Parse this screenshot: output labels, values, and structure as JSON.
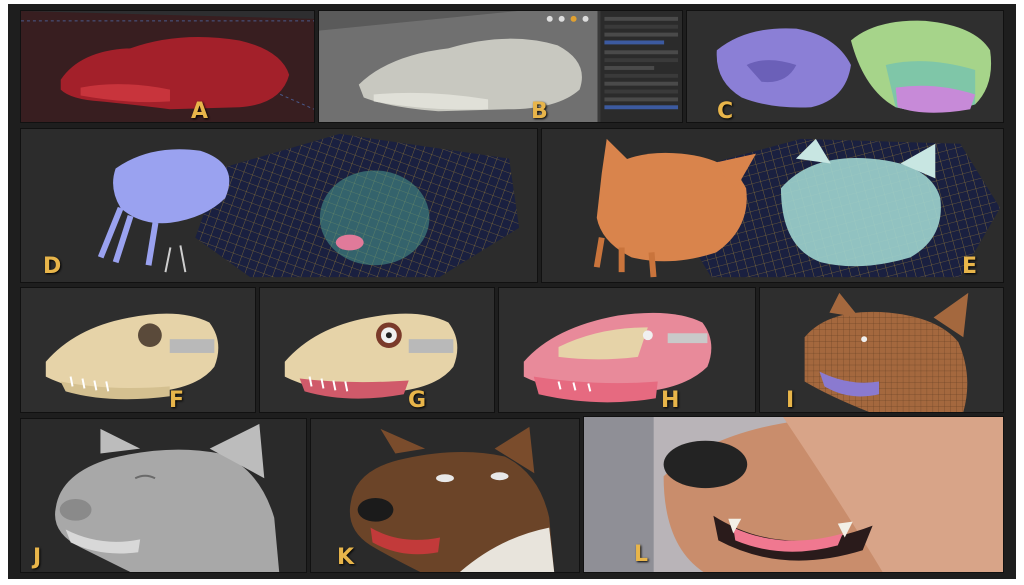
{
  "figure": {
    "panels": [
      {
        "id": "A",
        "label": "A",
        "content": "red skull scan volume"
      },
      {
        "id": "B",
        "label": "B",
        "content": "grey skull mesh with software panel"
      },
      {
        "id": "C",
        "label": "C",
        "content": "segmented skulls purple and green"
      },
      {
        "id": "D",
        "label": "D",
        "content": "blue skull with wireframe head"
      },
      {
        "id": "E",
        "label": "E",
        "content": "orange and teal head meshes with wireframe"
      },
      {
        "id": "F",
        "label": "F",
        "content": "skull model"
      },
      {
        "id": "G",
        "label": "G",
        "content": "skull with eye and tongue"
      },
      {
        "id": "H",
        "label": "H",
        "content": "skull with muscles"
      },
      {
        "id": "I",
        "label": "I",
        "content": "textured head wireframe"
      },
      {
        "id": "J",
        "label": "J",
        "content": "grey sculpted dog head"
      },
      {
        "id": "K",
        "label": "K",
        "content": "brown dog head render"
      },
      {
        "id": "L",
        "label": "L",
        "content": "close-up dog muzzle render"
      }
    ]
  },
  "colors": {
    "label": "#e8b54a",
    "background": "#1e1e1e",
    "skull": "#e6d3a8",
    "red_scan": "#a3202a",
    "purple": "#8b7fd6",
    "green": "#a6d48a",
    "orange": "#d9844c",
    "teal": "#9fd4cf",
    "blue": "#9aa2f0"
  }
}
